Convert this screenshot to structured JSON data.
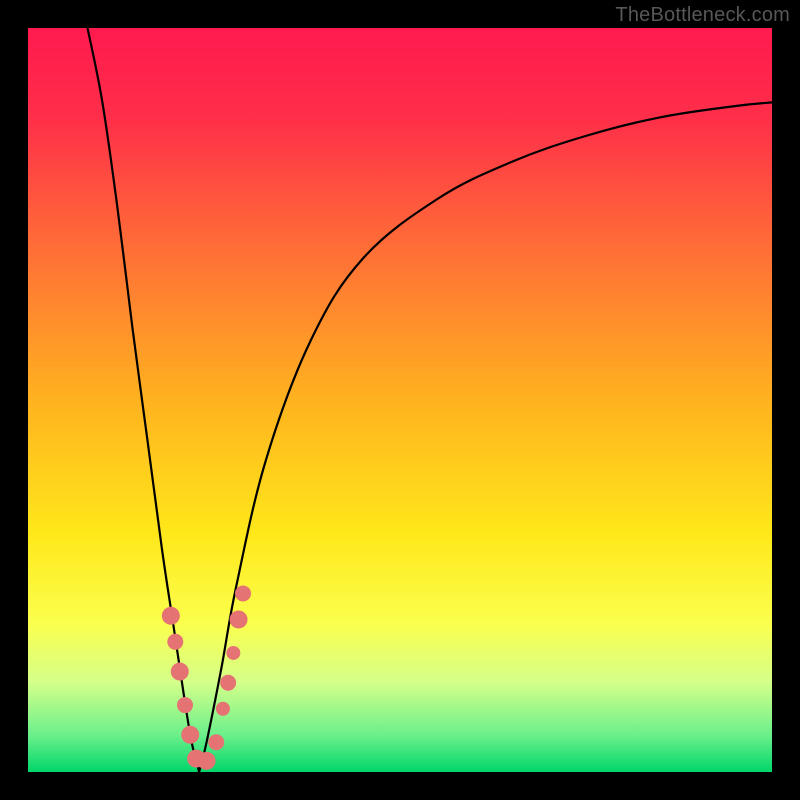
{
  "watermark": "TheBottleneck.com",
  "colors": {
    "frame": "#000000",
    "gradient_stops": [
      {
        "offset": 0.0,
        "color": "#ff1a4f"
      },
      {
        "offset": 0.12,
        "color": "#ff2e49"
      },
      {
        "offset": 0.3,
        "color": "#ff6f36"
      },
      {
        "offset": 0.5,
        "color": "#ffb21f"
      },
      {
        "offset": 0.68,
        "color": "#ffe81a"
      },
      {
        "offset": 0.8,
        "color": "#fbff4d"
      },
      {
        "offset": 0.88,
        "color": "#d4ff8a"
      },
      {
        "offset": 0.95,
        "color": "#6cf08b"
      },
      {
        "offset": 1.0,
        "color": "#00d66a"
      }
    ],
    "curve": "#000000",
    "markers_fill": "#e57373",
    "markers_stroke": "#b14f4f"
  },
  "chart_data": {
    "type": "line",
    "title": "",
    "xlabel": "",
    "ylabel": "",
    "xlim": [
      0,
      100
    ],
    "ylim": [
      0,
      100
    ],
    "grid": false,
    "series": [
      {
        "name": "left-branch",
        "x": [
          8,
          10,
          12,
          14,
          16,
          18,
          19.5,
          21,
          22,
          23
        ],
        "y": [
          100,
          90,
          76,
          60,
          45,
          30,
          20,
          10,
          4,
          0
        ]
      },
      {
        "name": "right-branch",
        "x": [
          23,
          24,
          26,
          28,
          32,
          38,
          45,
          55,
          65,
          75,
          85,
          95,
          100
        ],
        "y": [
          0,
          4,
          14,
          25,
          42,
          58,
          69,
          77,
          82,
          85.5,
          88,
          89.5,
          90
        ]
      }
    ],
    "markers": [
      {
        "x": 19.2,
        "y": 21.0,
        "r": 9
      },
      {
        "x": 19.8,
        "y": 17.5,
        "r": 8
      },
      {
        "x": 20.4,
        "y": 13.5,
        "r": 9
      },
      {
        "x": 21.1,
        "y": 9.0,
        "r": 8
      },
      {
        "x": 21.8,
        "y": 5.0,
        "r": 9
      },
      {
        "x": 22.6,
        "y": 1.8,
        "r": 9
      },
      {
        "x": 24.0,
        "y": 1.5,
        "r": 9
      },
      {
        "x": 25.3,
        "y": 4.0,
        "r": 8
      },
      {
        "x": 26.2,
        "y": 8.5,
        "r": 7
      },
      {
        "x": 26.9,
        "y": 12.0,
        "r": 8
      },
      {
        "x": 27.6,
        "y": 16.0,
        "r": 7
      },
      {
        "x": 28.3,
        "y": 20.5,
        "r": 9
      },
      {
        "x": 28.9,
        "y": 24.0,
        "r": 8
      }
    ],
    "annotations": []
  }
}
